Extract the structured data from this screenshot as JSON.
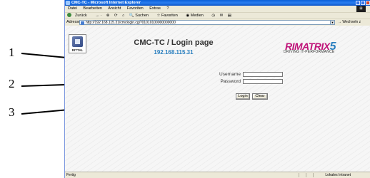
{
  "callouts": [
    "1",
    "2",
    "3"
  ],
  "window": {
    "title": "CMC-TC - Microsoft Internet Explorer",
    "menu": [
      "Datei",
      "Bearbeiten",
      "Ansicht",
      "Favoriten",
      "Extras",
      "?"
    ],
    "toolbar": [
      "Zurück",
      "Suchen",
      "Favoriten",
      "Medien"
    ],
    "address_label": "Adresse",
    "address_value": "http://192.168.115.31/cmclogin.cgi?01010100000000000",
    "go_label": "Wechseln z"
  },
  "page": {
    "title": "CMC-TC / Login page",
    "ip": "192.168.115.31",
    "logo_left": "RITTAL",
    "brand": "RIMATRIX",
    "brand_number": "5",
    "brand_tagline": "DRIVING IT-PERFORMANCE",
    "username_label": "Username",
    "password_label": "Password",
    "login_button": "Login",
    "clear_button": "Clear"
  },
  "status": {
    "left": "Fertig",
    "right": "Lokales Intranet"
  }
}
